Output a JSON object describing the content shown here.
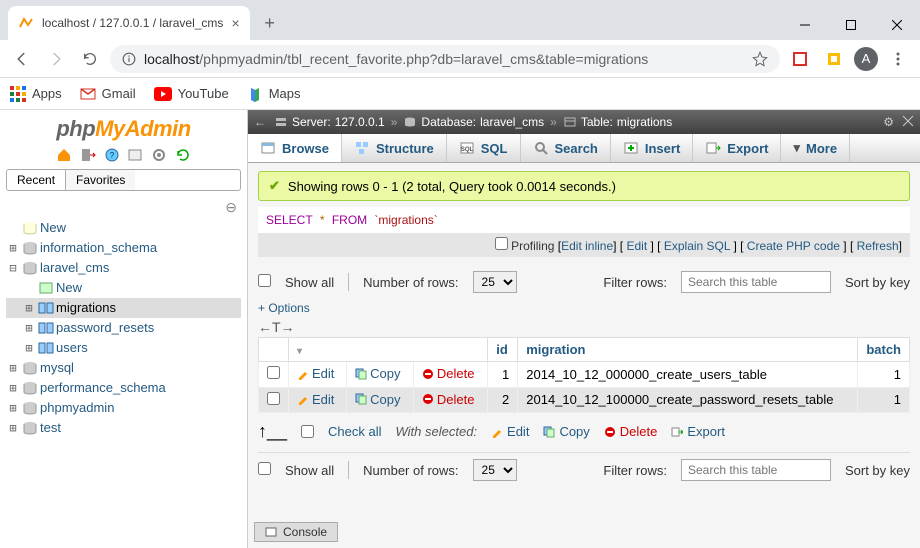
{
  "window": {
    "tab_title": "localhost / 127.0.0.1 / laravel_cms",
    "url_host": "localhost",
    "url_path": "/phpmyadmin/tbl_recent_favorite.php?db=laravel_cms&table=migrations",
    "avatar_letter": "A"
  },
  "bookmarks": {
    "apps": "Apps",
    "gmail": "Gmail",
    "youtube": "YouTube",
    "maps": "Maps"
  },
  "sidebar": {
    "logo1": "php",
    "logo2": "MyAdmin",
    "tab_recent": "Recent",
    "tab_favorites": "Favorites",
    "nodes": {
      "new": "New",
      "information_schema": "information_schema",
      "laravel_cms": "laravel_cms",
      "lc_new": "New",
      "migrations": "migrations",
      "password_resets": "password_resets",
      "users": "users",
      "mysql": "mysql",
      "performance_schema": "performance_schema",
      "phpmyadmin": "phpmyadmin",
      "test": "test"
    }
  },
  "breadcrumb": {
    "server_label": "Server:",
    "server_value": "127.0.0.1",
    "db_label": "Database:",
    "db_value": "laravel_cms",
    "table_label": "Table:",
    "table_value": "migrations"
  },
  "tabs": {
    "browse": "Browse",
    "structure": "Structure",
    "sql": "SQL",
    "search": "Search",
    "insert": "Insert",
    "export": "Export",
    "more": "More"
  },
  "success_msg": "Showing rows 0 - 1 (2 total, Query took 0.0014 seconds.)",
  "sql": {
    "kw1": "SELECT",
    "star": "*",
    "kw2": "FROM",
    "tbl": "`migrations`"
  },
  "sql_actions": {
    "profiling": "Profiling",
    "edit_inline": "Edit inline",
    "edit": "Edit",
    "explain": "Explain SQL",
    "create_php": "Create PHP code",
    "refresh": "Refresh"
  },
  "filters": {
    "show_all": "Show all",
    "num_rows_label": "Number of rows:",
    "num_rows_value": "25",
    "filter_label": "Filter rows:",
    "filter_placeholder": "Search this table",
    "sort_label": "Sort by key"
  },
  "options_link": "+ Options",
  "columns": {
    "id": "id",
    "migration": "migration",
    "batch": "batch"
  },
  "row_actions": {
    "edit": "Edit",
    "copy": "Copy",
    "delete": "Delete"
  },
  "rows": [
    {
      "id": "1",
      "migration": "2014_10_12_000000_create_users_table",
      "batch": "1"
    },
    {
      "id": "2",
      "migration": "2014_10_12_100000_create_password_resets_table",
      "batch": "1"
    }
  ],
  "checkall": {
    "check_all": "Check all",
    "with_selected": "With selected:",
    "edit": "Edit",
    "copy": "Copy",
    "delete": "Delete",
    "export": "Export"
  },
  "console": "Console"
}
